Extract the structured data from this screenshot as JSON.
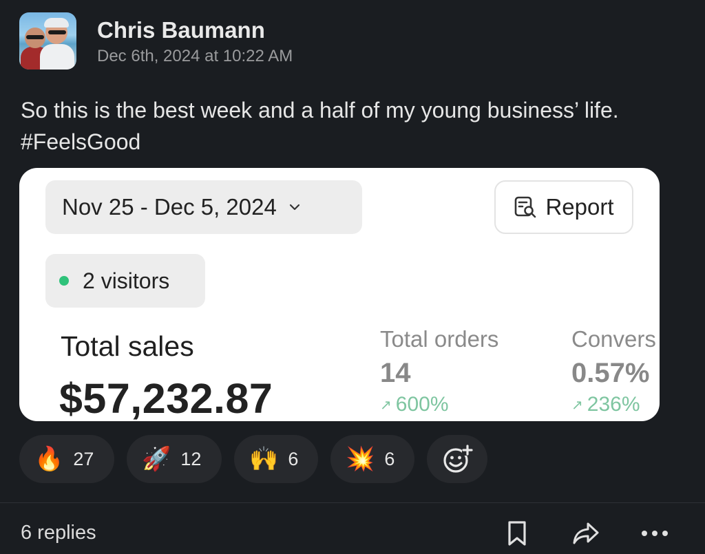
{
  "post": {
    "author": "Chris Baumann",
    "timestamp": "Dec 6th, 2024 at 10:22 AM",
    "message": "So this is the best week and a half of my young business’ life. #FeelsGood"
  },
  "card": {
    "date_range": "Nov 25 - Dec 5, 2024",
    "report_label": "Report",
    "visitors": "2 visitors",
    "total_sales_label": "Total sales",
    "total_sales_value": "$57,232.87",
    "metrics": [
      {
        "label": "Total orders",
        "value": "14",
        "change": "600%"
      },
      {
        "label": "Convers",
        "value": "0.57%",
        "change": "236%"
      }
    ]
  },
  "reactions": [
    {
      "emoji": "🔥",
      "icon": "fire-emoji",
      "count": "27"
    },
    {
      "emoji": "🚀",
      "icon": "rocket-emoji",
      "count": "12"
    },
    {
      "emoji": "🙌",
      "icon": "raised-hands-emoji",
      "count": "6"
    },
    {
      "emoji": "💥",
      "icon": "collision-emoji",
      "count": "6"
    }
  ],
  "footer": {
    "replies": "6 replies"
  },
  "colors": {
    "background": "#1a1d21",
    "card": "#ffffff",
    "status_green": "#2fc27a",
    "positive_change": "#7ec5a0"
  }
}
